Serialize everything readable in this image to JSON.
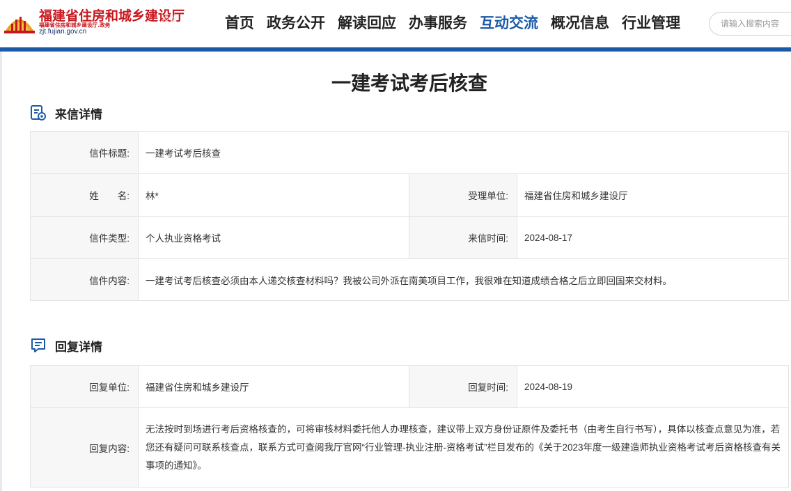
{
  "header": {
    "logo_title": "福建省住房和城乡建设厅",
    "logo_sub": "福建省住房和城乡建设厅.政务",
    "logo_url": "zjt.fujian.gov.cn",
    "ghost_text": "投诉",
    "nav": [
      {
        "label": "首页"
      },
      {
        "label": "政务公开"
      },
      {
        "label": "解读回应"
      },
      {
        "label": "办事服务"
      },
      {
        "label": "互动交流"
      },
      {
        "label": "概况信息"
      },
      {
        "label": "行业管理"
      }
    ],
    "active_nav": "互动交流",
    "accent_color": "#1a5aa8",
    "logo_color": "#c8161d",
    "search_placeholder": "请输入搜索内容"
  },
  "page_title": "一建考试考后核查",
  "letter": {
    "section_title": "来信详情",
    "section_icon": "document-eye-icon",
    "title_label": "信件标题:",
    "title_value": "一建考试考后核查",
    "name_label": "姓　　名:",
    "name_value": "林*",
    "unit_label": "受理单位:",
    "unit_value": "福建省住房和城乡建设厅",
    "type_label": "信件类型:",
    "type_value": "个人执业资格考试",
    "time_label": "来信时间:",
    "time_value": "2024-08-17",
    "content_label": "信件内容:",
    "content_value": "一建考试考后核查必须由本人递交核查材料吗？我被公司外派在南美项目工作，我很难在知道成绩合格之后立即回国来交材料。"
  },
  "reply": {
    "section_title": "回复详情",
    "section_icon": "chat-bubble-icon",
    "unit_label": "回复单位:",
    "unit_value": "福建省住房和城乡建设厅",
    "time_label": "回复时间:",
    "time_value": "2024-08-19",
    "content_label": "回复内容:",
    "content_value": "无法按时到场进行考后资格核查的，可将审核材料委托他人办理核查，建议带上双方身份证原件及委托书（由考生自行书写），具体以核查点意见为准，若您还有疑问可联系核查点，联系方式可查阅我厅官网“行业管理-执业注册-资格考试”栏目发布的《关于2023年度一级建造师执业资格考试考后资格核查有关事项的通知》。"
  }
}
